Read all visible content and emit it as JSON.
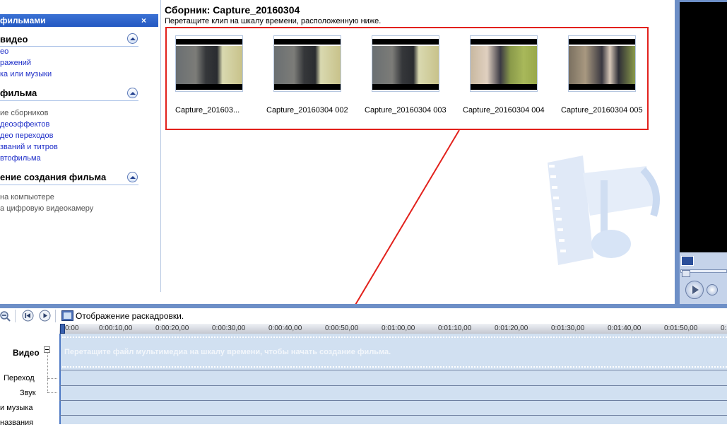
{
  "taskpane": {
    "header_title": "фильмами",
    "close_label": "×",
    "sections": [
      {
        "title": "видео",
        "items": [
          {
            "label": "ео",
            "style": "link"
          },
          {
            "label": "ражений",
            "style": "link"
          },
          {
            "label": "ка или музыки",
            "style": "link"
          }
        ]
      },
      {
        "title": "фильма",
        "items": [
          {
            "label": "ие сборников",
            "style": "gray"
          },
          {
            "label": "деоэффектов",
            "style": "link"
          },
          {
            "label": "део переходов",
            "style": "link"
          },
          {
            "label": "званий и титров",
            "style": "link"
          },
          {
            "label": "втофильма",
            "style": "link"
          }
        ]
      },
      {
        "title": "ение создания фильма",
        "items": [
          {
            "label": "на компьютере",
            "style": "gray"
          },
          {
            "label": "а цифровую видеокамеру",
            "style": "gray"
          }
        ]
      }
    ]
  },
  "collection": {
    "title": "Сборник: Capture_20160304",
    "hint": "Перетащите клип на шкалу времени, расположенную ниже.",
    "clips": [
      {
        "label": "Capture_201603...",
        "scene": "man"
      },
      {
        "label": "Capture_20160304 002",
        "scene": "man"
      },
      {
        "label": "Capture_20160304 003",
        "scene": "man"
      },
      {
        "label": "Capture_20160304 004",
        "scene": "women"
      },
      {
        "label": "Capture_20160304 005",
        "scene": "women"
      }
    ]
  },
  "timeline": {
    "storyboard_label": "Отображение раскадровки.",
    "ruler_ticks": [
      "0:00",
      "0:00:10,00",
      "0:00:20,00",
      "0:00:30,00",
      "0:00:40,00",
      "0:00:50,00",
      "0:01:00,00",
      "0:01:10,00",
      "0:01:20,00",
      "0:01:30,00",
      "0:01:40,00",
      "0:01:50,00",
      "0:"
    ],
    "video_track_label": "Видео",
    "drop_hint": "Перетащите файл мультимедиа на шкалу времени, чтобы начать создание фильма.",
    "tracks": [
      "Переход",
      "Звук",
      "и музыка",
      "названия"
    ]
  },
  "colors": {
    "accent_red": "#e2211c",
    "pane_blue": "#2458c2",
    "track_blue": "#d1e0f1"
  },
  "icons": [
    "zoom-out-icon",
    "rewind-icon",
    "play-icon",
    "storyboard-icon",
    "collapse-icon",
    "expand-preview-icon",
    "play-button-icon",
    "next-frame-icon",
    "film-music-logo-icon"
  ]
}
